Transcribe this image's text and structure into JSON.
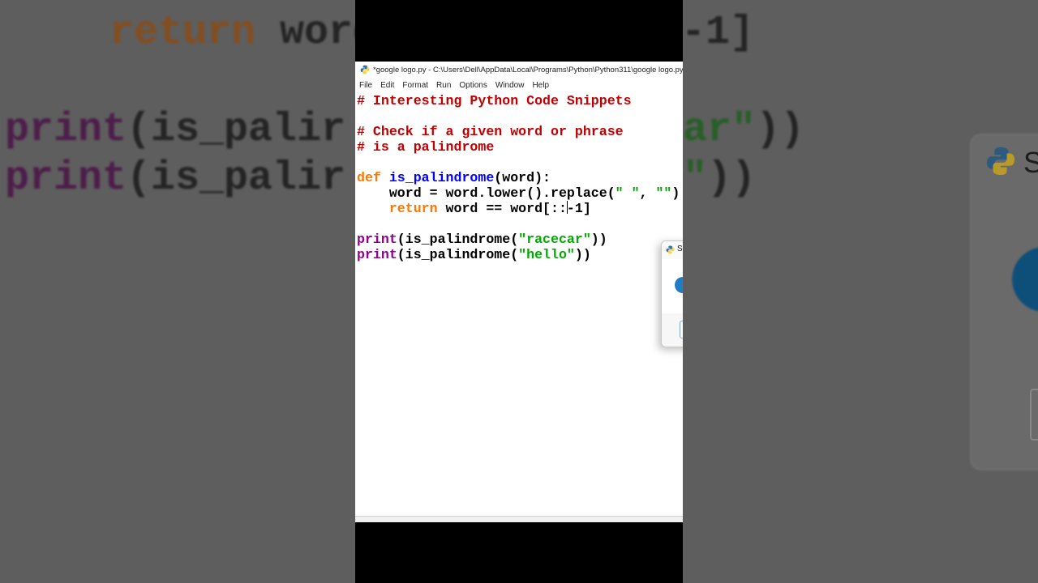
{
  "window": {
    "title": "*google logo.py - C:\\Users\\Dell\\AppData\\Local\\Programs\\Python\\Python311\\google logo.py",
    "menu": [
      "File",
      "Edit",
      "Format",
      "Run",
      "Options",
      "Window",
      "Help"
    ]
  },
  "code": {
    "line1": "# Interesting Python Code Snippets",
    "line3": "# Check if a given word or phrase",
    "line4": "# is a palindrome",
    "def_kw": "def",
    "func_name": "is_palindrome",
    "def_rest": "(word):",
    "line7_a": "    word = word.lower().replace(",
    "line7_s1": "\" \"",
    "line7_b": ", ",
    "line7_s2": "\"\"",
    "line7_c": ")",
    "return_kw": "return",
    "line8_a": " word == word[::",
    "line8_b": "-1]",
    "print_kw": "print",
    "call_open": "(is_palindrome(",
    "arg1": "\"racecar\"",
    "arg2": "\"hello\"",
    "call_close": "))"
  },
  "background": {
    "bg_line1_kw": "return",
    "bg_line1_rest": " word",
    "bg_line1_end": "-1]",
    "bg_print": "print",
    "bg_call": "(is_palir",
    "bg_str1_end": "ar\"",
    "bg_str2_end": "\"",
    "bg_close": "))",
    "bg_dialog_letter": "S"
  },
  "colors": {
    "comment": "#c00000",
    "keyword": "#ff7700",
    "function_name": "#0000ff",
    "builtin": "#900090",
    "string": "#00aa00"
  },
  "dialog": {
    "title_letter": "S"
  }
}
